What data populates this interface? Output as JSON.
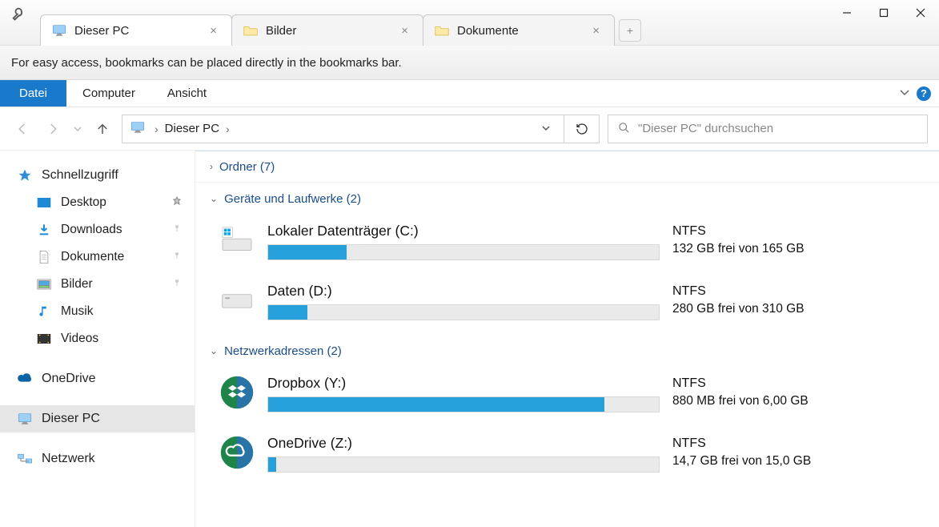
{
  "titlebar": {
    "tabs": [
      {
        "label": "Dieser PC",
        "active": true
      },
      {
        "label": "Bilder",
        "active": false
      },
      {
        "label": "Dokumente",
        "active": false
      }
    ]
  },
  "infobar": {
    "text": "For easy access, bookmarks can be placed directly in the bookmarks bar."
  },
  "ribbon": {
    "file": "Datei",
    "items": [
      "Computer",
      "Ansicht"
    ]
  },
  "address": {
    "root": "Dieser PC",
    "search_placeholder": "\"Dieser PC\" durchsuchen"
  },
  "sidebar": {
    "quick_label": "Schnellzugriff",
    "quick_items": [
      {
        "label": "Desktop"
      },
      {
        "label": "Downloads"
      },
      {
        "label": "Dokumente"
      },
      {
        "label": "Bilder"
      },
      {
        "label": "Musik"
      },
      {
        "label": "Videos"
      }
    ],
    "onedrive": "OneDrive",
    "thispc": "Dieser PC",
    "network": "Netzwerk"
  },
  "content": {
    "folders_header": "Ordner (7)",
    "drives_header": "Geräte und Laufwerke (2)",
    "network_header": "Netzwerkadressen (2)",
    "drives": [
      {
        "name": "Lokaler Datenträger (C:)",
        "fs": "NTFS",
        "free_text": "132 GB frei von 165 GB",
        "fill_pct": 20
      },
      {
        "name": "Daten (D:)",
        "fs": "NTFS",
        "free_text": "280 GB frei von 310 GB",
        "fill_pct": 10
      }
    ],
    "netloc": [
      {
        "name": "Dropbox (Y:)",
        "fs": "NTFS",
        "free_text": "880 MB frei von 6,00 GB",
        "fill_pct": 86,
        "color": "#2a9fd6"
      },
      {
        "name": "OneDrive (Z:)",
        "fs": "NTFS",
        "free_text": "14,7 GB frei von 15,0 GB",
        "fill_pct": 2,
        "color": "#2a9fd6"
      }
    ]
  }
}
